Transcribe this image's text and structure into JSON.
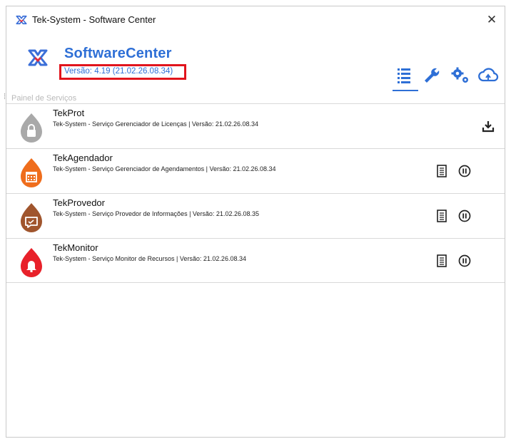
{
  "window": {
    "title": "Tek-System - Software Center",
    "close_glyph": "✕"
  },
  "brand": {
    "name": "SoftwareCenter",
    "version": "Versão: 4.19 (21.02.26.08.34)",
    "accent": "#2e6fd6",
    "highlight": "#e1141c"
  },
  "toolbar": [
    {
      "icon": "list-icon",
      "active": true
    },
    {
      "icon": "wrench-icon",
      "active": false
    },
    {
      "icon": "gears-icon",
      "active": false
    },
    {
      "icon": "cloud-sync-icon",
      "active": false
    }
  ],
  "section": {
    "label": "Painel de Serviços"
  },
  "services": [
    {
      "name": "TekProt",
      "desc": "Tek-System - Serviço Gerenciador de Licenças | Versão: 21.02.26.08.34",
      "color": "#a9a9a9",
      "icon": "lock-icon",
      "actions": [
        "download-icon"
      ]
    },
    {
      "name": "TekAgendador",
      "desc": "Tek-System - Serviço Gerenciador de Agendamentos | Versão: 21.02.26.08.34",
      "color": "#ef6d1c",
      "icon": "calendar-icon",
      "actions": [
        "log-icon",
        "pause-icon"
      ]
    },
    {
      "name": "TekProvedor",
      "desc": "Tek-System - Serviço Provedor de Informações | Versão: 21.02.26.08.35",
      "color": "#a0552d",
      "icon": "message-icon",
      "actions": [
        "log-icon",
        "pause-icon"
      ]
    },
    {
      "name": "TekMonitor",
      "desc": "Tek-System - Serviço Monitor de Recursos | Versão: 21.02.26.08.34",
      "color": "#e8212a",
      "icon": "bell-icon",
      "actions": [
        "log-icon",
        "pause-icon"
      ]
    }
  ]
}
